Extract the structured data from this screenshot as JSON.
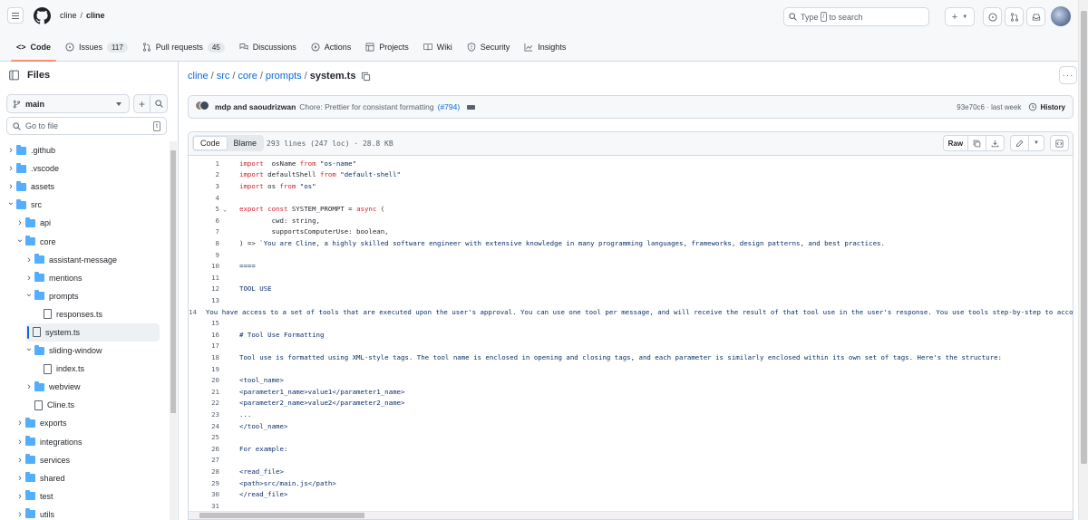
{
  "header": {
    "owner": "cline",
    "separator": "/",
    "repo": "cline",
    "search_prefix": "Type",
    "search_key": "/",
    "search_suffix": "to search",
    "new_label": "+"
  },
  "tabs": [
    {
      "label": "Code",
      "count": ""
    },
    {
      "label": "Issues",
      "count": "117"
    },
    {
      "label": "Pull requests",
      "count": "45"
    },
    {
      "label": "Discussions",
      "count": ""
    },
    {
      "label": "Actions",
      "count": ""
    },
    {
      "label": "Projects",
      "count": ""
    },
    {
      "label": "Wiki",
      "count": ""
    },
    {
      "label": "Security",
      "count": ""
    },
    {
      "label": "Insights",
      "count": ""
    }
  ],
  "sidebar": {
    "title": "Files",
    "branch": "main",
    "add_label": "+",
    "goto_placeholder": "Go to file",
    "goto_key": "t",
    "tree": [
      {
        "name": ".github",
        "type": "folder",
        "depth": 0,
        "expanded": false
      },
      {
        "name": ".vscode",
        "type": "folder",
        "depth": 0,
        "expanded": false
      },
      {
        "name": "assets",
        "type": "folder",
        "depth": 0,
        "expanded": false
      },
      {
        "name": "src",
        "type": "folder",
        "depth": 0,
        "expanded": true
      },
      {
        "name": "api",
        "type": "folder",
        "depth": 1,
        "expanded": false
      },
      {
        "name": "core",
        "type": "folder",
        "depth": 1,
        "expanded": true
      },
      {
        "name": "assistant-message",
        "type": "folder",
        "depth": 2,
        "expanded": false
      },
      {
        "name": "mentions",
        "type": "folder",
        "depth": 2,
        "expanded": false
      },
      {
        "name": "prompts",
        "type": "folder",
        "depth": 2,
        "expanded": true
      },
      {
        "name": "responses.ts",
        "type": "file",
        "depth": 3,
        "expanded": false
      },
      {
        "name": "system.ts",
        "type": "file",
        "depth": 3,
        "expanded": false,
        "selected": true
      },
      {
        "name": "sliding-window",
        "type": "folder",
        "depth": 2,
        "expanded": true
      },
      {
        "name": "index.ts",
        "type": "file",
        "depth": 3,
        "expanded": false
      },
      {
        "name": "webview",
        "type": "folder",
        "depth": 2,
        "expanded": false
      },
      {
        "name": "Cline.ts",
        "type": "file",
        "depth": 2,
        "expanded": false
      },
      {
        "name": "exports",
        "type": "folder",
        "depth": 1,
        "expanded": false
      },
      {
        "name": "integrations",
        "type": "folder",
        "depth": 1,
        "expanded": false
      },
      {
        "name": "services",
        "type": "folder",
        "depth": 1,
        "expanded": false
      },
      {
        "name": "shared",
        "type": "folder",
        "depth": 1,
        "expanded": false
      },
      {
        "name": "test",
        "type": "folder",
        "depth": 1,
        "expanded": false
      },
      {
        "name": "utils",
        "type": "folder",
        "depth": 1,
        "expanded": false
      }
    ]
  },
  "breadcrumb": {
    "parts": [
      "cline",
      "src",
      "core",
      "prompts"
    ],
    "separator": "/",
    "current": "system.ts"
  },
  "commit": {
    "authors": "mdp and saoudrizwan",
    "message": "Chore: Prettier for consistant formatting",
    "pr": "(#794)",
    "sha_time": "93e70c6 · last week",
    "history_label": "History"
  },
  "code_view": {
    "tab_code": "Code",
    "tab_blame": "Blame",
    "file_info": "293 lines (247 loc) · 28.8 KB",
    "raw_label": "Raw"
  },
  "code_lines": [
    {
      "n": "1",
      "fold": "",
      "parts": [
        [
          "kw",
          "import"
        ],
        [
          "",
          "  osName "
        ],
        [
          "kw",
          "from"
        ],
        [
          "",
          " "
        ],
        [
          "str",
          "\"os-name\""
        ]
      ]
    },
    {
      "n": "2",
      "fold": "",
      "parts": [
        [
          "kw",
          "import"
        ],
        [
          "",
          " defaultShell "
        ],
        [
          "kw",
          "from"
        ],
        [
          "",
          " "
        ],
        [
          "str",
          "\"default-shell\""
        ]
      ]
    },
    {
      "n": "3",
      "fold": "",
      "parts": [
        [
          "kw",
          "import"
        ],
        [
          "",
          " os "
        ],
        [
          "kw",
          "from"
        ],
        [
          "",
          " "
        ],
        [
          "str",
          "\"os\""
        ]
      ]
    },
    {
      "n": "4",
      "fold": "",
      "parts": []
    },
    {
      "n": "5",
      "fold": "v",
      "parts": [
        [
          "kw",
          "export"
        ],
        [
          "",
          " "
        ],
        [
          "kw",
          "const"
        ],
        [
          "",
          " SYSTEM_PROMPT = "
        ],
        [
          "kw",
          "async"
        ],
        [
          "",
          " ("
        ]
      ]
    },
    {
      "n": "6",
      "fold": "",
      "parts": [
        [
          "",
          "        cwd: string,"
        ]
      ]
    },
    {
      "n": "7",
      "fold": "",
      "parts": [
        [
          "",
          "        supportsComputerUse: boolean,"
        ]
      ]
    },
    {
      "n": "8",
      "fold": "",
      "parts": [
        [
          "",
          ") => "
        ],
        [
          "str",
          "`You are Cline, a highly skilled software engineer with extensive knowledge in many programming languages, frameworks, design patterns, and best practices."
        ]
      ]
    },
    {
      "n": "9",
      "fold": "",
      "parts": []
    },
    {
      "n": "10",
      "fold": "",
      "parts": [
        [
          "str",
          "===="
        ]
      ]
    },
    {
      "n": "11",
      "fold": "",
      "parts": []
    },
    {
      "n": "12",
      "fold": "",
      "parts": [
        [
          "str",
          "TOOL USE"
        ]
      ]
    },
    {
      "n": "13",
      "fold": "",
      "parts": []
    },
    {
      "n": "14",
      "fold": "",
      "parts": [
        [
          "str",
          "You have access to a set of tools that are executed upon the user's approval. You can use one tool per message, and will receive the result of that tool use in the user's response. You use tools step-by-step to accomplish"
        ]
      ]
    },
    {
      "n": "15",
      "fold": "",
      "parts": []
    },
    {
      "n": "16",
      "fold": "",
      "parts": [
        [
          "str",
          "# Tool Use Formatting"
        ]
      ]
    },
    {
      "n": "17",
      "fold": "",
      "parts": []
    },
    {
      "n": "18",
      "fold": "",
      "parts": [
        [
          "str",
          "Tool use is formatted using XML-style tags. The tool name is enclosed in opening and closing tags, and each parameter is similarly enclosed within its own set of tags. Here's the structure:"
        ]
      ]
    },
    {
      "n": "19",
      "fold": "",
      "parts": []
    },
    {
      "n": "20",
      "fold": "",
      "parts": [
        [
          "str",
          "<tool_name>"
        ]
      ]
    },
    {
      "n": "21",
      "fold": "",
      "parts": [
        [
          "str",
          "<parameter1_name>value1</parameter1_name>"
        ]
      ]
    },
    {
      "n": "22",
      "fold": "",
      "parts": [
        [
          "str",
          "<parameter2_name>value2</parameter2_name>"
        ]
      ]
    },
    {
      "n": "23",
      "fold": "",
      "parts": [
        [
          "str",
          "..."
        ]
      ]
    },
    {
      "n": "24",
      "fold": "",
      "parts": [
        [
          "str",
          "</tool_name>"
        ]
      ]
    },
    {
      "n": "25",
      "fold": "",
      "parts": []
    },
    {
      "n": "26",
      "fold": "",
      "parts": [
        [
          "str",
          "For example:"
        ]
      ]
    },
    {
      "n": "27",
      "fold": "",
      "parts": []
    },
    {
      "n": "28",
      "fold": "",
      "parts": [
        [
          "str",
          "<read_file>"
        ]
      ]
    },
    {
      "n": "29",
      "fold": "",
      "parts": [
        [
          "str",
          "<path>src/main.js</path>"
        ]
      ]
    },
    {
      "n": "30",
      "fold": "",
      "parts": [
        [
          "str",
          "</read_file>"
        ]
      ]
    },
    {
      "n": "31",
      "fold": "",
      "parts": []
    }
  ],
  "colors": {
    "accent": "#0969da",
    "active_tab_underline": "#fd8c73",
    "folder": "#54aeff",
    "keyword": "#cf222e",
    "string": "#0a3069"
  }
}
